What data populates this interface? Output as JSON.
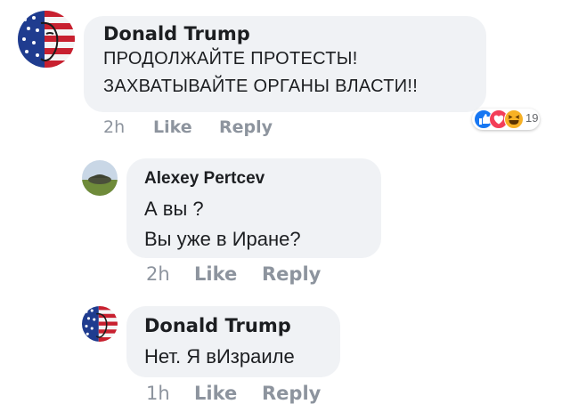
{
  "comments": [
    {
      "author": "Donald Trump",
      "lines": [
        "ПРОДОЛЖАЙТЕ ПРОТЕСТЫ!",
        "ЗАХВАТЫВАЙТЕ ОРГАНЫ ВЛАСТИ!!"
      ],
      "time": "2h",
      "like": "Like",
      "reply": "Reply",
      "reactions": {
        "icons": [
          "like-reaction",
          "love-reaction",
          "haha-reaction"
        ],
        "count": "19"
      }
    },
    {
      "author": "Alexey Pertcev",
      "lines": [
        "А вы ?",
        "Вы уже в Иране?"
      ],
      "time": "2h",
      "like": "Like",
      "reply": "Reply"
    },
    {
      "author": "Donald Trump",
      "lines": [
        "Нет. Я вИзраиле"
      ],
      "time": "1h",
      "like": "Like",
      "reply": "Reply"
    }
  ],
  "colors": {
    "bubble": "#f0f2f5",
    "meta": "#8d949e",
    "like_blue": "#1877f2",
    "love_red": "#f33e58",
    "haha_yellow": "#f7b125"
  }
}
